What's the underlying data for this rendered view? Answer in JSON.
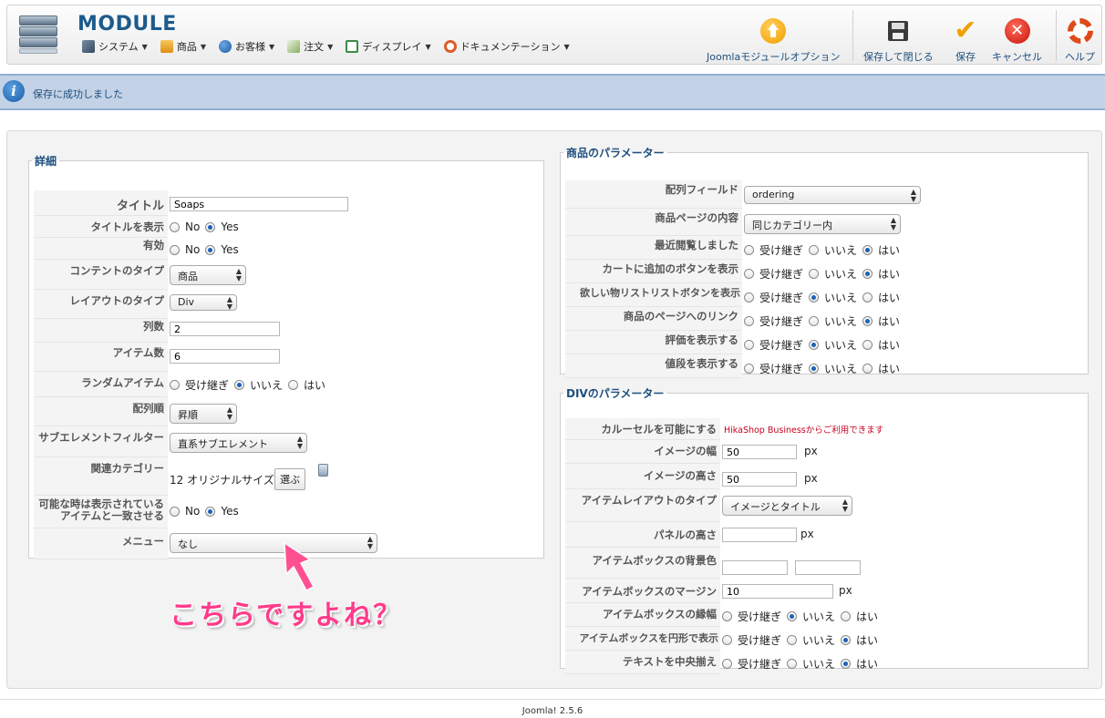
{
  "header": {
    "title": "MODULE",
    "menu": [
      {
        "label": "システム",
        "icon": "wrench-icon"
      },
      {
        "label": "商品",
        "icon": "box-icon"
      },
      {
        "label": "お客様",
        "icon": "users-icon"
      },
      {
        "label": "注文",
        "icon": "edit-icon"
      },
      {
        "label": "ディスプレイ",
        "icon": "display-icon"
      },
      {
        "label": "ドキュメンテーション",
        "icon": "lifebuoy-icon"
      }
    ],
    "toolbar": {
      "options_label": "Joomlaモジュールオプション",
      "save_close_label": "保存して閉じる",
      "save_label": "保存",
      "cancel_label": "キャンセル",
      "help_label": "ヘルプ"
    }
  },
  "message": "保存に成功しました",
  "details": {
    "legend": "詳細",
    "title_label": "タイトル",
    "title_value": "Soaps",
    "show_title_label": "タイトルを表示",
    "enabled_label": "有効",
    "content_type_label": "コンテントのタイプ",
    "content_type_value": "商品",
    "layout_type_label": "レイアウトのタイプ",
    "layout_type_value": "Div",
    "columns_label": "列数",
    "columns_value": "2",
    "items_label": "アイテム数",
    "items_value": "6",
    "random_label": "ランダムアイテム",
    "order_label": "配列順",
    "order_value": "昇順",
    "filter_label": "サブエレメントフィルター",
    "filter_value": "直系サブエレメント",
    "related_label": "関連カテゴリー",
    "related_value": "12 オリジナルサイズ",
    "select_button": "選ぶ",
    "match_label_1": "可能な時は表示されている",
    "match_label_2": "アイテムと一致させる",
    "menu_label": "メニュー",
    "menu_value": "なし",
    "no": "No",
    "yes": "Yes",
    "inherit": "受け継ぎ",
    "iie": "いいえ",
    "hai": "はい"
  },
  "product_params": {
    "legend": "商品のパラメーター",
    "order_field_label": "配列フィールド",
    "order_field_value": "ordering",
    "page_content_label": "商品ページの内容",
    "page_content_value": "同じカテゴリー内",
    "recent_label": "最近閲覧しました",
    "cart_label": "カートに追加のボタンを表示",
    "wishlist_label": "欲しい物リストリストボタンを表示",
    "link_label": "商品のページへのリンク",
    "rating_label": "評価を表示する",
    "price_label": "値段を表示する"
  },
  "div_params": {
    "legend": "DIVのパラメーター",
    "carousel_label": "カルーセルを可能にする",
    "carousel_note": "HikaShop Businessからご利用できます",
    "img_width_label": "イメージの幅",
    "img_width_value": "50",
    "img_height_label": "イメージの高さ",
    "img_height_value": "50",
    "item_layout_label": "アイテムレイアウトのタイプ",
    "item_layout_value": "イメージとタイトル",
    "panel_height_label": "パネルの高さ",
    "bg_color_label": "アイテムボックスの背景色",
    "margin_label": "アイテムボックスのマージン",
    "margin_value": "10",
    "border_label": "アイテムボックスの縁幅",
    "rounded_label": "アイテムボックスを円形で表示",
    "center_label": "テキストを中央揃え",
    "px": "px"
  },
  "annotation": "こちらですよね？",
  "footer": "Joomla! 2.5.6"
}
